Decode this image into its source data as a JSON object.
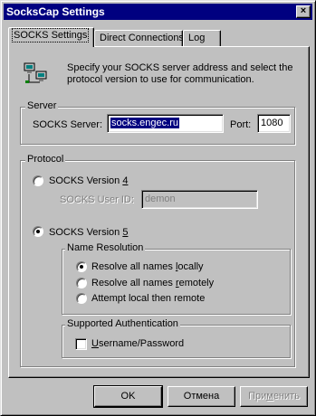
{
  "window": {
    "title": "SocksCap Settings",
    "close_glyph": "×"
  },
  "tabs": [
    {
      "label": "SOCKS Settings",
      "active": true
    },
    {
      "label": "Direct Connections",
      "active": false
    },
    {
      "label": "Log",
      "active": false
    }
  ],
  "intro": {
    "icon": "network-computers-icon",
    "line1": "Specify your SOCKS server address and select the",
    "line2": "protocol version to use for communication."
  },
  "server": {
    "group_label": "Server",
    "server_label": "SOCKS Server:",
    "server_value": "socks.engec.ru",
    "port_label": "Port:",
    "port_value": "1080"
  },
  "protocol": {
    "group_label": "Protocol",
    "v4_label": "SOCKS Version ",
    "v4_key": "4",
    "user_id_label": "SOCKS User ID:",
    "user_id_value": "demon",
    "v5_label": "SOCKS Version ",
    "v5_key": "5",
    "selected": "5",
    "name_resolution": {
      "group_label": "Name Resolution",
      "opt1_pre": "Resolve all names ",
      "opt1_key": "l",
      "opt1_post": "ocally",
      "opt2_pre": "Resolve all names ",
      "opt2_key": "r",
      "opt2_post": "emotely",
      "opt3": "Attempt local then remote",
      "selected": 1
    },
    "auth": {
      "group_label": "Supported Authentication",
      "check_key": "U",
      "check_post": "sername/Password",
      "checked": false
    }
  },
  "buttons": {
    "ok": "OK",
    "cancel": "Отмена",
    "apply_pre": "При",
    "apply_key": "м",
    "apply_post": "енить"
  }
}
